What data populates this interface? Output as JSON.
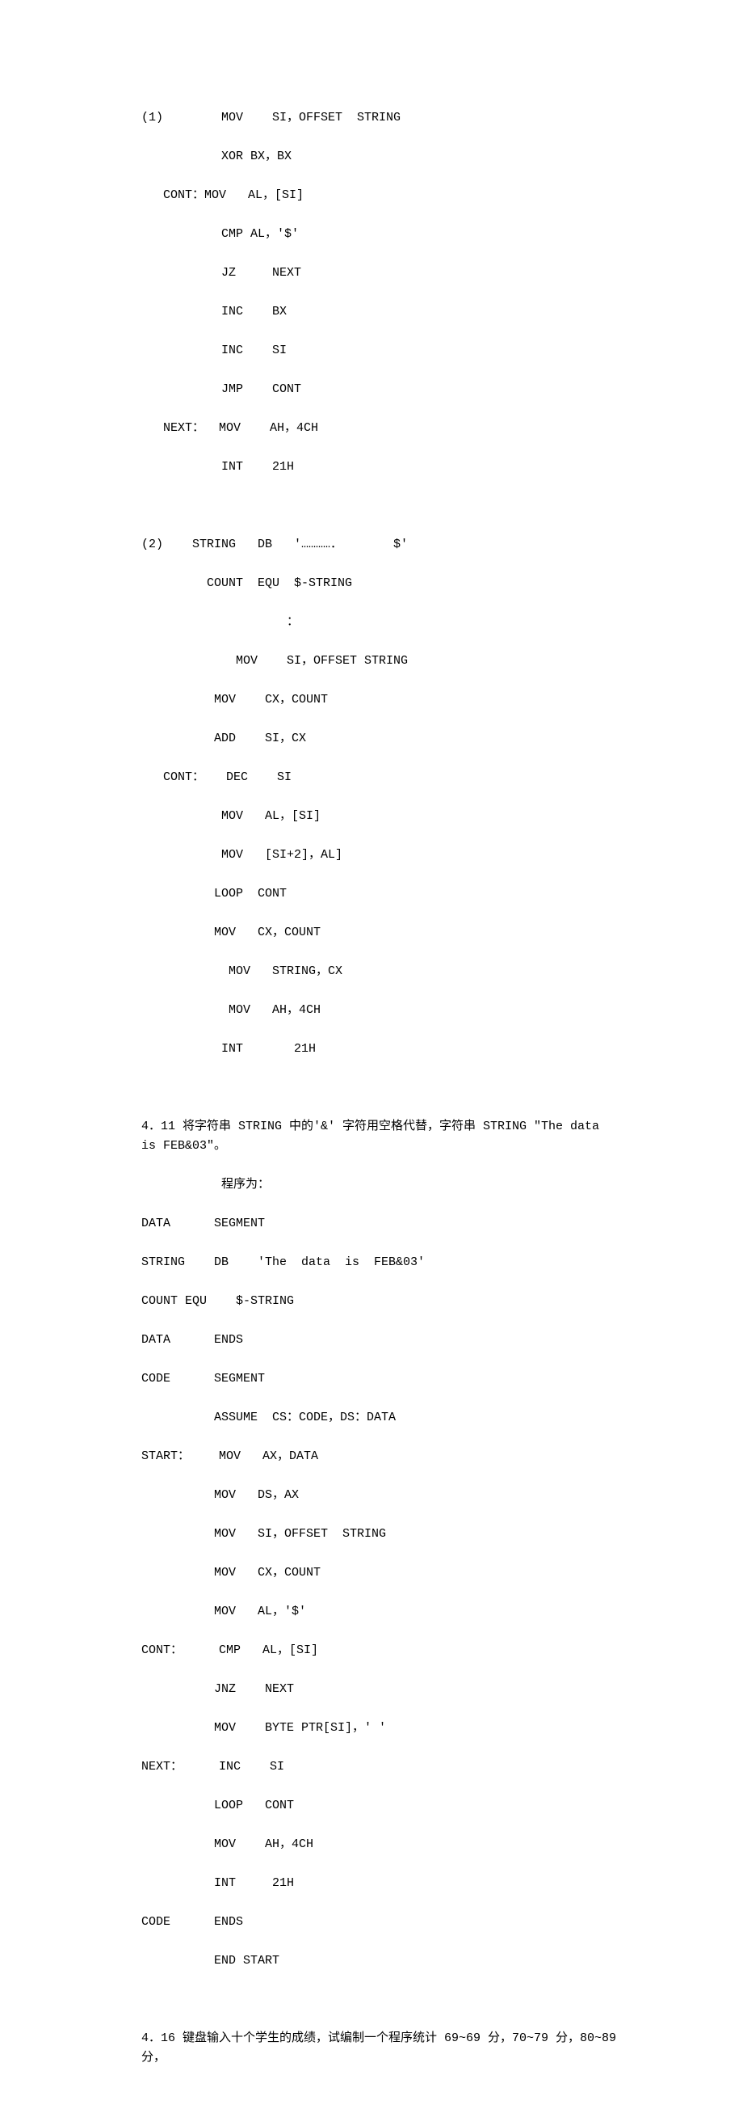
{
  "block1": {
    "lines": [
      "(1)        MOV    SI，OFFSET  STRING",
      "           XOR BX，BX",
      "   CONT：MOV   AL，[SI]",
      "           CMP AL，'$'",
      "           JZ     NEXT",
      "           INC    BX",
      "           INC    SI",
      "           JMP    CONT",
      "   NEXT：  MOV    AH，4CH",
      "           INT    21H"
    ]
  },
  "block2": {
    "lines": [
      "(2)    STRING   DB   '…………．       $'",
      "         COUNT  EQU  $-STRING",
      "                    ：",
      "             MOV    SI，OFFSET STRING",
      "          MOV    CX，COUNT",
      "          ADD    SI，CX",
      "   CONT：   DEC    SI",
      "           MOV   AL，[SI]",
      "           MOV   [SI+2]，AL]",
      "          LOOP  CONT",
      "          MOV   CX，COUNT",
      "            MOV   STRING，CX",
      "            MOV   AH，4CH",
      "           INT       21H"
    ]
  },
  "q411": {
    "title": "4．11  将字符串 STRING 中的'&'  字符用空格代替，字符串 STRING \"The data is FEB&03\"。",
    "note": "程序为：",
    "code": [
      "DATA      SEGMENT",
      "STRING    DB    'The  data  is  FEB&03'",
      "COUNT EQU    $-STRING",
      "DATA      ENDS",
      "CODE      SEGMENT",
      "          ASSUME  CS：CODE，DS：DATA",
      "START：    MOV   AX，DATA",
      "          MOV   DS，AX",
      "          MOV   SI，OFFSET  STRING",
      "          MOV   CX，COUNT",
      "          MOV   AL，'$'",
      "CONT：     CMP   AL，[SI]",
      "          JNZ    NEXT",
      "          MOV    BYTE PTR[SI]，' '",
      "NEXT：     INC    SI",
      "          LOOP   CONT",
      "          MOV    AH，4CH",
      "          INT     21H",
      "CODE      ENDS",
      "          END START"
    ]
  },
  "q416": {
    "text": "4．16 键盘输入十个学生的成绩，试编制一个程序统计 69~69 分，70~79 分，80~89 分，"
  }
}
